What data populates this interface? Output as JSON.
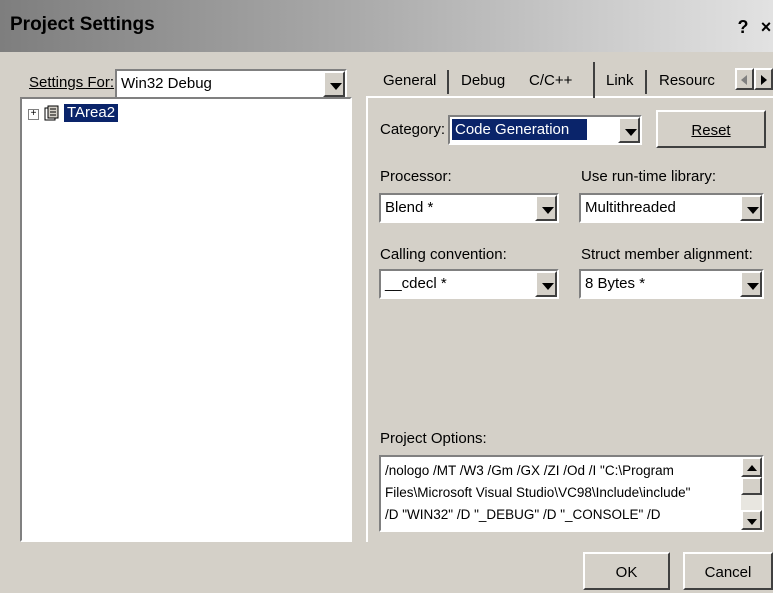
{
  "dialog": {
    "title": "Project Settings",
    "help_label": "?",
    "close_label": "×"
  },
  "settings_for": {
    "label": "Settings For:",
    "value": "Win32 Debug"
  },
  "tree": {
    "expand_glyph": "+",
    "item_label": "TArea2"
  },
  "tabs": {
    "general": "General",
    "debug": "Debug",
    "cpp": "C/C++",
    "link": "Link",
    "resource": "Resourc"
  },
  "category": {
    "label": "Category:",
    "value": "Code Generation",
    "reset_label": "Reset"
  },
  "processor": {
    "label": "Processor:",
    "value": "Blend *"
  },
  "runtime": {
    "label": "Use run-time library:",
    "value": "Multithreaded"
  },
  "calling": {
    "label": "Calling convention:",
    "value": "__cdecl *"
  },
  "struct": {
    "label": "Struct member alignment:",
    "value": "8 Bytes *"
  },
  "options": {
    "label": "Project Options:",
    "line1": "/nologo /MT /W3 /Gm /GX /ZI /Od /I \"C:\\Program",
    "line2": "Files\\Microsoft Visual Studio\\VC98\\Include\\include\"",
    "line3": "/D \"WIN32\" /D \"_DEBUG\" /D \"_CONSOLE\" /D"
  },
  "buttons": {
    "ok": "OK",
    "cancel": "Cancel"
  }
}
